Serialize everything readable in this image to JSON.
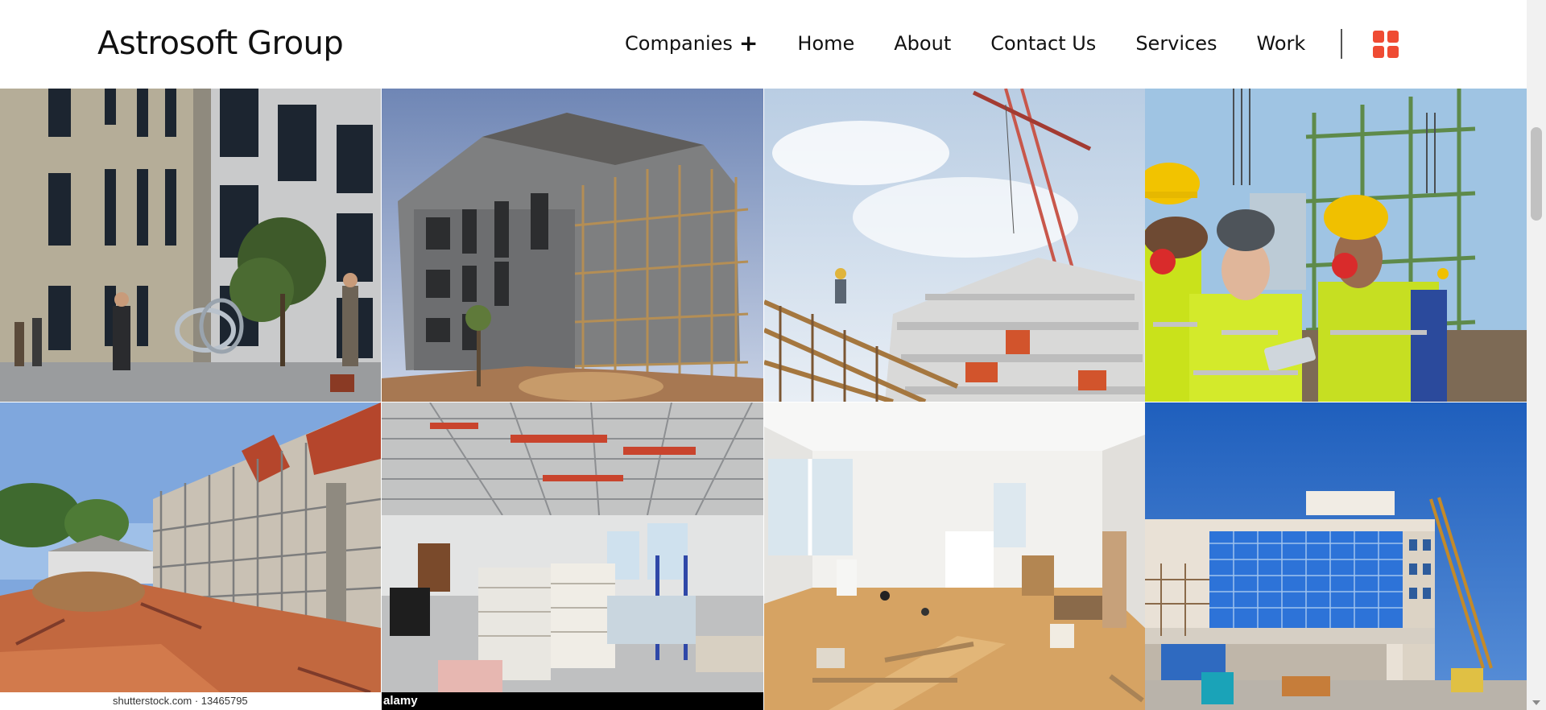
{
  "header": {
    "brand": "Astrosoft Group",
    "nav": [
      {
        "label": "Companies",
        "has_submenu": true
      },
      {
        "label": "Home"
      },
      {
        "label": "About"
      },
      {
        "label": "Contact Us"
      },
      {
        "label": "Services"
      },
      {
        "label": "Work"
      }
    ],
    "submenu_indicator": "+",
    "menu_icon": "grid-menu-icon",
    "accent_color": "#ef4b33"
  },
  "gallery": {
    "tiles": [
      {
        "subject": "modern office building with pedestrians"
      },
      {
        "subject": "concrete building under construction with scaffolding"
      },
      {
        "subject": "high-rise under construction with crane"
      },
      {
        "subject": "construction workers with hard hats reviewing tablet"
      },
      {
        "subject": "building facade with scaffolding and red soil",
        "watermark": "shutterstock.com · 13465795"
      },
      {
        "subject": "office interior fit-out with open ceiling grid",
        "watermark": "alamy"
      },
      {
        "subject": "interior renovation with bright windows"
      },
      {
        "subject": "glass facade building near crane"
      }
    ]
  }
}
